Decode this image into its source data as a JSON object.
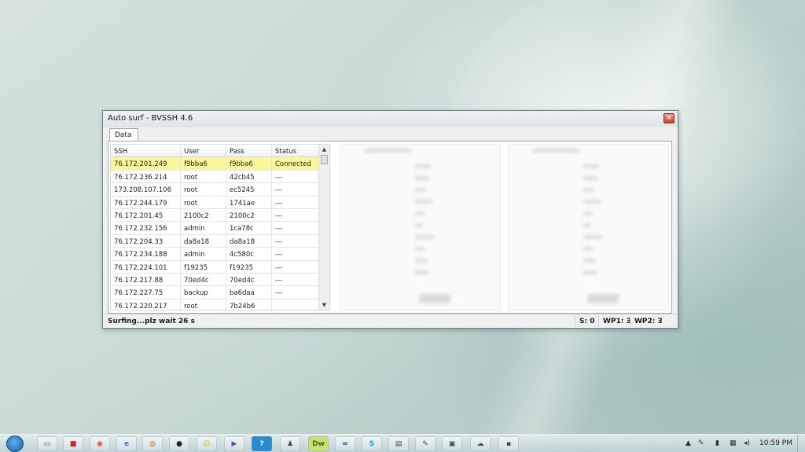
{
  "window": {
    "title": "Auto surf - BVSSH 4.6",
    "close_glyph": "×"
  },
  "tabs": [
    {
      "label": "Data"
    }
  ],
  "table": {
    "columns": [
      "SSH",
      "User",
      "Pass",
      "Status"
    ],
    "rows": [
      [
        "76.172.201.249",
        "f9bba6",
        "f9bba6",
        "Connected"
      ],
      [
        "76.172.236.214",
        "root",
        "42cb45",
        "---"
      ],
      [
        "173.208.107.106",
        "root",
        "ec5245",
        "---"
      ],
      [
        "76.172.244.179",
        "root",
        "1741ae",
        "---"
      ],
      [
        "76.172.201.45",
        "2100c2",
        "2100c2",
        "---"
      ],
      [
        "76.172.232.156",
        "admin",
        "1ca78c",
        "---"
      ],
      [
        "76.172.204.33",
        "da8a18",
        "da8a18",
        "---"
      ],
      [
        "76.172.234.188",
        "admin",
        "4c580c",
        "---"
      ],
      [
        "76.172.224.101",
        "f19235",
        "f19235",
        "---"
      ],
      [
        "76.172.217.88",
        "70ed4c",
        "70ed4c",
        "---"
      ],
      [
        "76.172.227.75",
        "backup",
        "ba6daa",
        "---"
      ],
      [
        "76.172.220.217",
        "root",
        "7b24b6",
        ""
      ]
    ],
    "selected_row_color": "#fbf69a"
  },
  "statusbar": {
    "message": "Surfing...plz wait 26 s",
    "s": "S: 0",
    "wp1": "WP1: 3",
    "wp2": "WP2: 3"
  },
  "taskbar": {
    "clock": "10:59 PM",
    "icons": [
      "explorer-icon",
      "app-red-icon",
      "chrome-icon",
      "ie-icon",
      "firefox-icon",
      "app-dark-icon",
      "smiley-icon",
      "vs-icon",
      "app-blue-icon",
      "spy-icon",
      "dreamweaver-icon",
      "link-icon",
      "skype-icon",
      "notepad-icon",
      "paint-icon",
      "window-icon",
      "network-icon",
      "terminal-icon"
    ],
    "dw_label": "Dw",
    "question_label": "?"
  }
}
